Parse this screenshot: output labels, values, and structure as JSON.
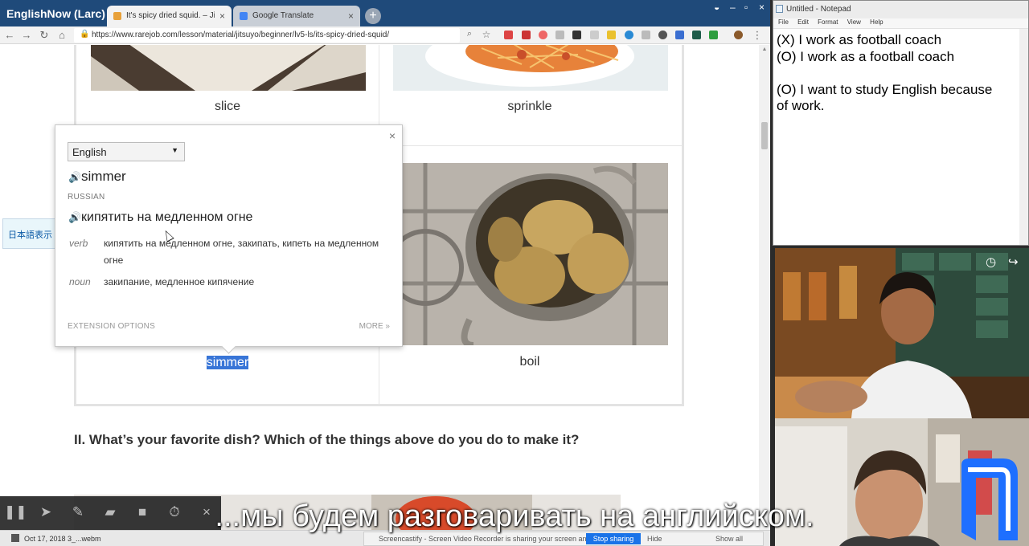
{
  "browser": {
    "window_title": "EnglishNow (Larc)",
    "tabs": [
      {
        "label": "It's spicy dried squid. – Jitsuyo E",
        "active": true
      },
      {
        "label": "Google Translate",
        "active": false
      }
    ],
    "new_tab": "+",
    "url": "https://www.rarejob.com/lesson/material/jitsuyo/beginner/lv5-ls/its-spicy-dried-squid/"
  },
  "page": {
    "words": {
      "top_left": "slice",
      "top_right": "sprinkle",
      "bottom_left": "simmer",
      "bottom_right": "boil"
    },
    "question": "II. What’s your favorite dish? Which of the things above do you do to make it?",
    "side_button": "日本語表示"
  },
  "translate_popup": {
    "close": "×",
    "source_language": "English",
    "word": "simmer",
    "target_language": "RUSSIAN",
    "translation": "кипятить на медленном огне",
    "definitions": [
      {
        "pos": "verb",
        "text": "кипятить на медленном огне, закипать, кипеть на медленном огне"
      },
      {
        "pos": "noun",
        "text": "закипание, медленное кипячение"
      }
    ],
    "extension_options": "EXTENSION OPTIONS",
    "more": "MORE »"
  },
  "notepad": {
    "title": "Untitled - Notepad",
    "menu": [
      "File",
      "Edit",
      "Format",
      "View",
      "Help"
    ],
    "text": "(X) I work as football coach\n(O) I work as a football coach\n\n(O) I want to study English because\nof work."
  },
  "bottom": {
    "download_item": "Oct 17, 2018 3_...webm",
    "share_text": "Screencastify - Screen Video Recorder is sharing your screen and audio.",
    "stop_sharing": "Stop sharing",
    "hide": "Hide",
    "show_all": "Show all"
  },
  "subtitle": "...мы будем разговаривать на английском.",
  "colors": {
    "tabstrip": "#1f4a7a",
    "selection": "#3875d7",
    "logo": "#1e6fff"
  }
}
